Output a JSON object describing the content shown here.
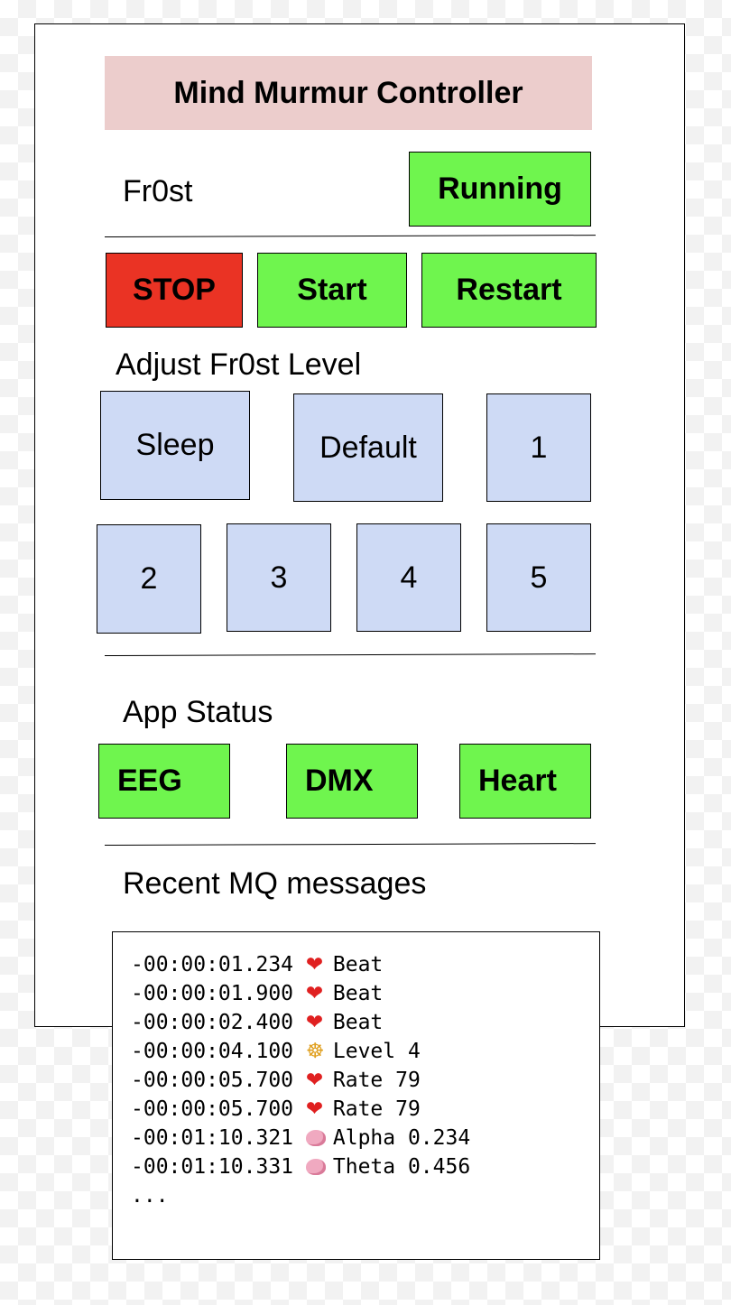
{
  "title": "Mind Murmur Controller",
  "frost": {
    "name": "Fr0st",
    "status": "Running"
  },
  "controls": {
    "stop": "STOP",
    "start": "Start",
    "restart": "Restart"
  },
  "level": {
    "heading": "Adjust Fr0st Level",
    "buttons": [
      "Sleep",
      "Default",
      "1",
      "2",
      "3",
      "4",
      "5"
    ]
  },
  "app_status": {
    "heading": "App Status",
    "items": [
      "EEG",
      "DMX",
      "Heart"
    ]
  },
  "mq": {
    "heading": "Recent MQ messages",
    "messages": [
      {
        "time": "-00:00:01.234",
        "icon": "heart-icon",
        "text": "Beat"
      },
      {
        "time": "-00:00:01.900",
        "icon": "heart-icon",
        "text": "Beat"
      },
      {
        "time": "-00:00:02.400",
        "icon": "heart-icon",
        "text": "Beat"
      },
      {
        "time": "-00:00:04.100",
        "icon": "meditate-icon",
        "text": "Level 4"
      },
      {
        "time": "-00:00:05.700",
        "icon": "heart-icon",
        "text": "Rate 79"
      },
      {
        "time": "-00:00:05.700",
        "icon": "heart-icon",
        "text": "Rate 79"
      },
      {
        "time": "-00:01:10.321",
        "icon": "brain-icon",
        "text": "Alpha 0.234"
      },
      {
        "time": "-00:01:10.331",
        "icon": "brain-icon",
        "text": "Theta 0.456"
      }
    ],
    "ellipsis": "..."
  },
  "colors": {
    "green": "#6ff54e",
    "red": "#ea3324",
    "blue": "#cedaf5",
    "title_bg": "#eccdcc"
  }
}
